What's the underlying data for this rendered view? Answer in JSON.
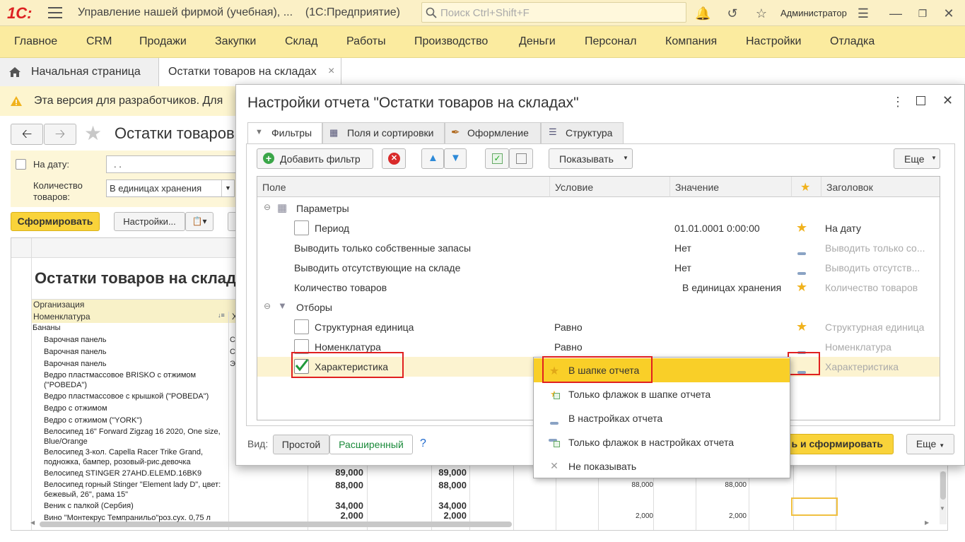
{
  "topbar": {
    "logo": "1С:",
    "app_title": "Управление нашей фирмой (учебная), ...",
    "platform": "(1С:Предприятие)",
    "search_placeholder": "Поиск Ctrl+Shift+F",
    "user": "Администратор"
  },
  "menu": [
    "Главное",
    "CRM",
    "Продажи",
    "Закупки",
    "Склад",
    "Работы",
    "Производство",
    "Деньги",
    "Персонал",
    "Компания",
    "Настройки",
    "Отладка"
  ],
  "tabs": {
    "home": "Начальная страница",
    "open": "Остатки товаров на складах",
    "close": "×"
  },
  "warning": "Эта версия для разработчиков. Для",
  "background_report": {
    "title": "Остатки товаров",
    "date_label": "На дату:",
    "date_value": ". .",
    "qty_label": "Количество товаров:",
    "qty_value": "В единицах хранения",
    "generate": "Сформировать",
    "settings": "Настройки...",
    "report_heading": "Остатки товаров на склад",
    "col_org": "Организация",
    "col_item": "Номенклатура",
    "col_x": "Х",
    "items": [
      "Бананы",
      "Варочная панель",
      "Варочная панель",
      "Варочная панель",
      "Ведро пластмассовое BRISKO с отжимом (\"POBEDA\")",
      "Ведро пластмассовое с крышкой (\"POBEDA\")",
      "Ведро с отжимом",
      "Ведро с отжимом (\"YORK\")",
      "Велосипед 16\" Forward Zigzag 16 2020, One size, Blue/Orange",
      "Велосипед 3-кол. Capella Racer Trike Grand, подножка, бампер, розовый-рис.девочка",
      "Велосипед STINGER 27AHD.ELEMD.16BK9",
      "Велосипед горный Stinger \"Element lady D\", цвет: бежевый, 26\", рама 15\"",
      "Веник с палкой (Сербия)",
      "Вино \"Монтекрус Темпранильо\"роз.сух. 0,75 л"
    ],
    "x_marks": [
      "С",
      "С",
      "Э"
    ],
    "num_rows": [
      {
        "a": "89,000",
        "b": "89,000",
        "c": "",
        "d": ""
      },
      {
        "a": "88,000",
        "b": "88,000",
        "c": "88,000",
        "d": "88,000"
      },
      {
        "a": "34,000",
        "b": "34,000",
        "c": "",
        "d": ""
      },
      {
        "a": "2,000",
        "b": "2,000",
        "c": "2,000",
        "d": "2,000"
      }
    ]
  },
  "dialog": {
    "title": "Настройки отчета \"Остатки товаров на складах\"",
    "tabs": [
      "Фильтры",
      "Поля и сортировки",
      "Оформление",
      "Структура"
    ],
    "add_filter": "Добавить фильтр",
    "show": "Показывать",
    "more": "Еще",
    "columns": {
      "field": "Поле",
      "condition": "Условие",
      "value": "Значение",
      "title": "Заголовок"
    },
    "rows": [
      {
        "field": "Параметры",
        "condition": "",
        "value": "",
        "title": ""
      },
      {
        "field": "Период",
        "condition": "",
        "value": "01.01.0001 0:00:00",
        "title": "На дату"
      },
      {
        "field": "Выводить только собственные запасы",
        "condition": "",
        "value": "Нет",
        "title": "Выводить только со..."
      },
      {
        "field": "Выводить отсутствующие на складе",
        "condition": "",
        "value": "Нет",
        "title": "Выводить отсутств..."
      },
      {
        "field": "Количество товаров",
        "condition": "",
        "value": "В единицах хранения",
        "title": "Количество товаров"
      },
      {
        "field": "Отборы",
        "condition": "",
        "value": "",
        "title": ""
      },
      {
        "field": "Структурная единица",
        "condition": "Равно",
        "value": "",
        "title": "Структурная единица"
      },
      {
        "field": "Номенклатура",
        "condition": "Равно",
        "value": "",
        "title": "Номенклатура"
      },
      {
        "field": "Характеристика",
        "condition": "",
        "value": "",
        "title": "Характеристика"
      }
    ],
    "view_label": "Вид:",
    "view_simple": "Простой",
    "view_extended": "Расширенный",
    "help": "?",
    "footer_button": "ь и сформировать",
    "footer_more": "Еще"
  },
  "popup": [
    "В шапке отчета",
    "Только флажок в шапке отчета",
    "В настройках отчета",
    "Только флажок в настройках отчета",
    "Не показывать"
  ],
  "colors": {
    "accent": "#f9d33a",
    "menu_bg": "#fbeb9f",
    "highlight": "#f5c518",
    "red_box": "#e02020"
  }
}
